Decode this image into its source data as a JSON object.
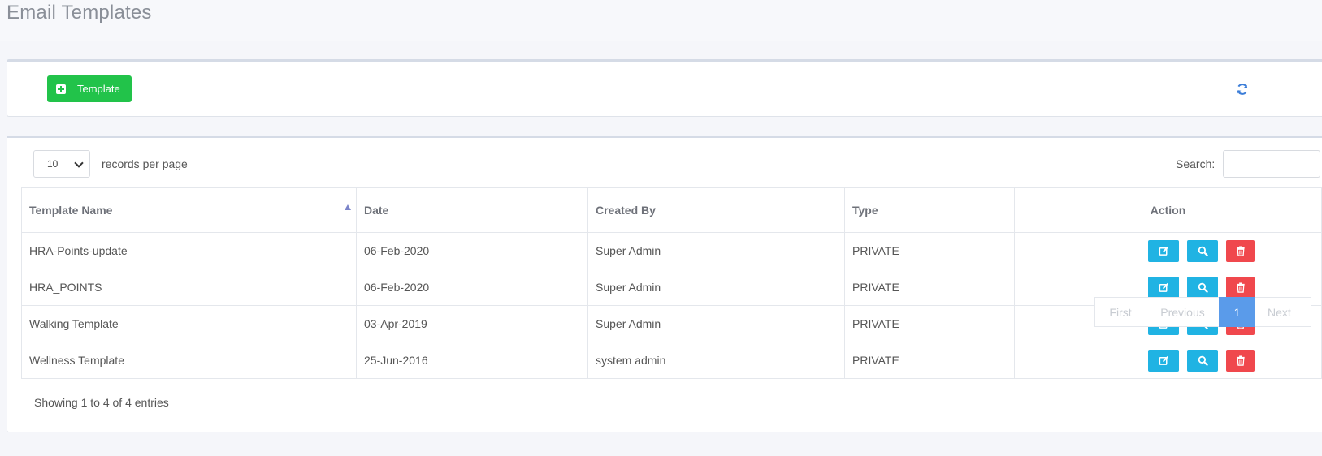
{
  "page": {
    "title": "Email Templates"
  },
  "toolbar": {
    "add_label": "Template",
    "colors": {
      "add": "#22c34a",
      "refresh": "#3b7dd8"
    }
  },
  "list": {
    "length_value": "10",
    "records_per_page_label": "records per page",
    "search_label": "Search:",
    "search_value": "",
    "columns": [
      "Template Name",
      "Date",
      "Created By",
      "Type",
      "Action"
    ],
    "rows": [
      {
        "name": "HRA-Points-update",
        "date": "06-Feb-2020",
        "created_by": "Super Admin",
        "type": "PRIVATE"
      },
      {
        "name": "HRA_POINTS",
        "date": "06-Feb-2020",
        "created_by": "Super Admin",
        "type": "PRIVATE"
      },
      {
        "name": "Walking Template",
        "date": "03-Apr-2019",
        "created_by": "Super Admin",
        "type": "PRIVATE"
      },
      {
        "name": "Wellness Template",
        "date": "25-Jun-2016",
        "created_by": "system admin",
        "type": "PRIVATE"
      }
    ],
    "info": "Showing 1 to 4 of 4 entries",
    "pagination": {
      "first": "First",
      "previous": "Previous",
      "current": "1",
      "next": "Next"
    },
    "icons": {
      "edit": "edit-icon",
      "view": "search-icon",
      "delete": "trash-icon",
      "sort": "sort-asc-icon"
    },
    "colors": {
      "edit": "#20b3e3",
      "view": "#20b3e3",
      "delete": "#f0484d",
      "active_page": "#5a9bea"
    }
  }
}
